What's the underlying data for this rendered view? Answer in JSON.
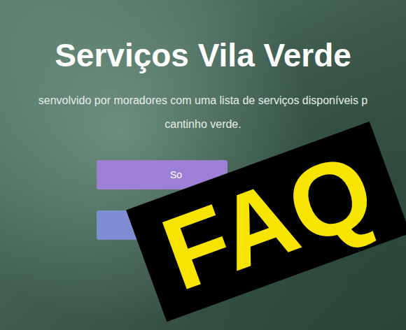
{
  "page": {
    "title": "Serviços Vila Verde",
    "subtitle_lines": [
      "senvolvido por moradores com uma lista de serviços disponíveis p",
      "cantinho verde."
    ]
  },
  "buttons": [
    {
      "label": "So",
      "color": "#9b80d6"
    },
    {
      "color": "#7f8dd2"
    }
  ],
  "sticker": {
    "text": "FAQ"
  }
}
